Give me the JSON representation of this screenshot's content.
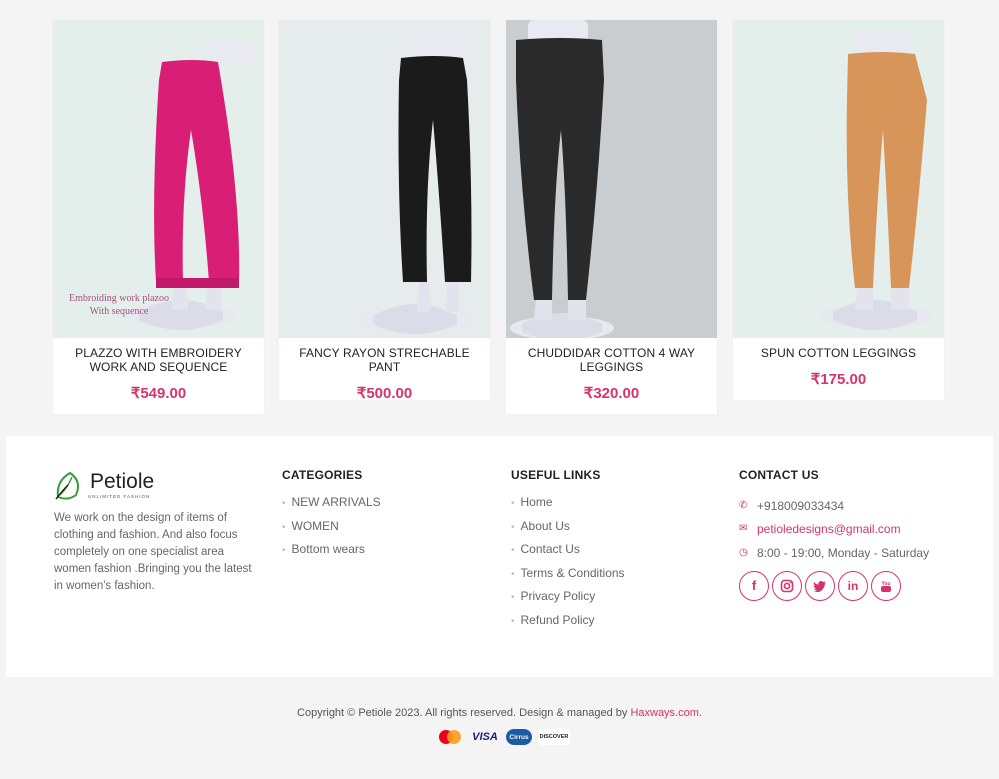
{
  "products": [
    {
      "name": "PLAZZO WITH EMBROIDERY WORK AND SEQUENCE",
      "price": "₹549.00",
      "caption_line1": "Embroiding work plazoo",
      "caption_line2": "With sequence",
      "bg": "#e4efec",
      "pant_color": "#d81f75"
    },
    {
      "name": "FANCY RAYON STRECHABLE PANT",
      "price": "₹500.00",
      "bg": "#e6eceb",
      "pant_color": "#1b1b1b"
    },
    {
      "name": "CHUDDIDAR COTTON 4 WAY LEGGINGS",
      "price": "₹320.00",
      "bg": "#c9cdd0",
      "pant_color": "#2a2a2a"
    },
    {
      "name": "SPUN COTTON LEGGINGS",
      "price": "₹175.00",
      "bg": "#e4efec",
      "pant_color": "#d7955a"
    }
  ],
  "footer": {
    "brand": "Petiole",
    "brand_tagline": "UNLIMITED FASHION",
    "about": "We work on the design of items of clothing and fashion. And also focus completely on one specialist area women fashion .Bringing you the latest in women's fashion.",
    "categories": {
      "title": "CATEGORIES",
      "items": [
        "NEW ARRIVALS",
        "WOMEN",
        "Bottom wears"
      ]
    },
    "useful_links": {
      "title": "USEFUL LINKS",
      "items": [
        "Home",
        "About Us",
        "Contact Us",
        "Terms & Conditions",
        "Privacy Policy",
        "Refund Policy"
      ]
    },
    "contact": {
      "title": "CONTACT US",
      "phone": "+918009033434",
      "email": "petioledesigns@gmail.com",
      "hours": "8:00 - 19:00, Monday - Saturday"
    },
    "socials": [
      "facebook-icon",
      "instagram-icon",
      "twitter-icon",
      "linkedin-icon",
      "youtube-icon"
    ]
  },
  "copyright": {
    "text": "Copyright © Petiole 2023. All rights reserved. Design & managed by ",
    "link": "Haxways.com",
    "end": "."
  },
  "payments": [
    "MasterCard",
    "VISA",
    "Cirrus",
    "DISCOVER"
  ],
  "colors": {
    "accent": "#d6336c"
  }
}
